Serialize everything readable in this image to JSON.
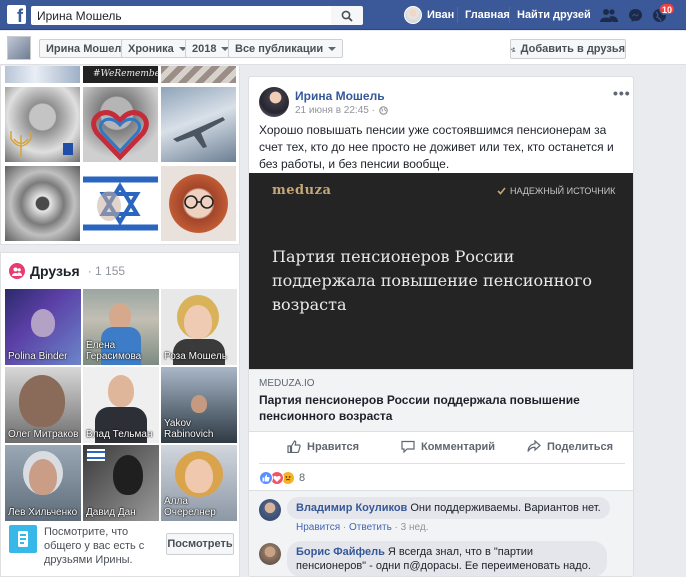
{
  "topbar": {
    "logo": "f",
    "search_value": "Ирина Мошель",
    "user_name": "Иван",
    "home_label": "Главная",
    "find_friends_label": "Найти друзей",
    "notif_count": "10",
    "brand_color": "#3b5998"
  },
  "subbar": {
    "crumbs": [
      "Ирина Мошель",
      "Хроника",
      "2018",
      "Все публикации"
    ],
    "add_friend_label": "Добавить в друзья"
  },
  "photos": {
    "caption_fragment": "#WeRemember"
  },
  "friends": {
    "title": "Друзья",
    "count": "· 1 155",
    "names": [
      "Polina Binder",
      "Елена Герасимова",
      "Роза Мошель",
      "Олег Митраков",
      "Влад Тельман",
      "Yakov Rabinovich",
      "Лев Хильченко",
      "Давид Дан",
      "Алла Очерелнер"
    ],
    "mutual_text": "Посмотрите, что общего у вас есть с друзьями Ирины.",
    "mutual_button": "Посмотреть"
  },
  "post": {
    "author": "Ирина Мошель",
    "time": "21 июня в 22:45 ·",
    "more": "•••",
    "text": "Хорошо повышать пенсии уже состоявшимся пенсионерам за счет тех, кто до нее просто не доживет или тех, кто останется и без работы, и без пенсии вообще.",
    "card": {
      "logo": "meduza",
      "trusted_label": "НАДЕЖНЫЙ ИСТОЧНИК",
      "headline": "Партия пенсионеров России поддержала повышение пенсионного возраста"
    },
    "link": {
      "domain": "MEDUZA.IO",
      "title": "Партия пенсионеров России поддержала повышение пенсионного возраста"
    },
    "actions": {
      "like": "Нравится",
      "comment": "Комментарий",
      "share": "Поделиться"
    },
    "reaction_count": "8"
  },
  "comments": [
    {
      "author": "Владимир Коуликов",
      "text": "Они поддерживаемы. Вариантов нет.",
      "like": "Нравится",
      "reply": "Ответить",
      "age": "3 нед."
    },
    {
      "author": "Борис Файфель",
      "text": "Я всегда знал, что в \"партии пенсионеров\" - одни п@дорасы. Ее переименовать надо."
    }
  ]
}
